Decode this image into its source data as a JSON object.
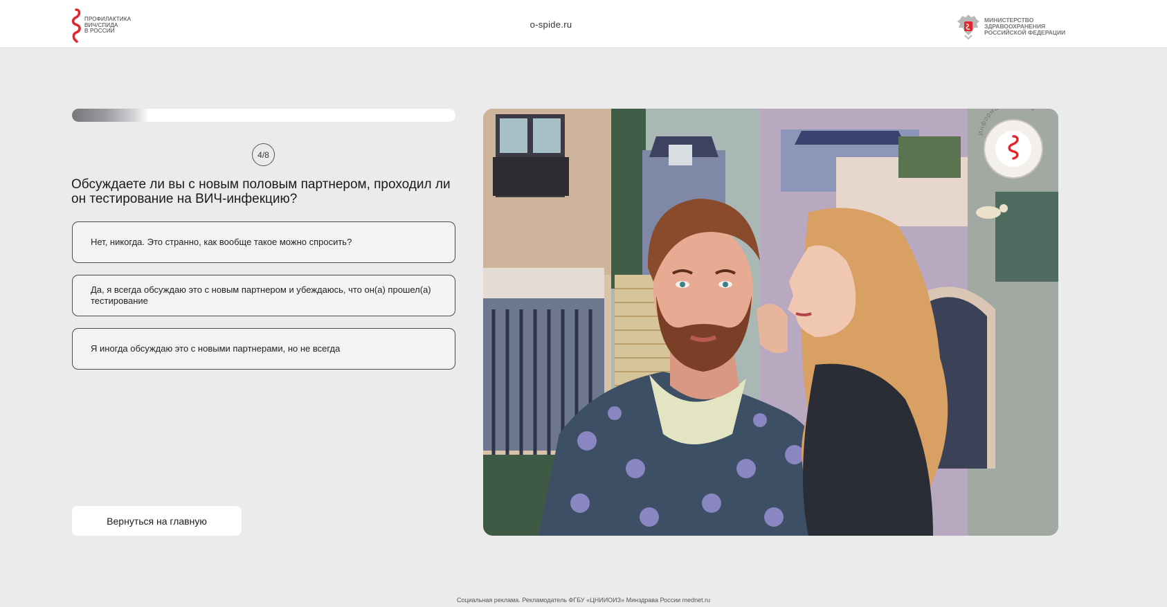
{
  "header": {
    "logo_text": [
      "ПРОФИЛАКТИКА",
      "ВИЧ/СПИДа",
      "В РОССИИ"
    ],
    "site_link": "o-spide.ru",
    "ministry_text": [
      "МИНИСТЕРСТВО",
      "ЗДРАВООХРАНЕНИЯ",
      "РОССИЙСКОЙ ФЕДЕРАЦИИ"
    ]
  },
  "quiz": {
    "progress": 0.2,
    "step": "4/8",
    "question": "Обсуждаете ли вы с новым половым партнером, проходил ли он тестирование на ВИЧ-инфекцию?",
    "options": [
      "Нет, никогда. Это странно, как вообще такое можно спросить?",
      "Да, я всегда обсуждаю это с новым партнером и убеждаюсь, что он(а) прошел(а) тестирование",
      "Я иногда обсуждаю это с новыми партнерами, но не всегда"
    ],
    "back_label": "Вернуться на главную"
  },
  "illustration": {
    "badge_text": "Информация о ВИЧ"
  },
  "footer": {
    "text": "Социальная реклама. Рекламодатель ФГБУ «ЦНИИОИЗ» Минздрава России mednet.ru"
  },
  "colors": {
    "accent": "#e3262c",
    "background": "#ebebeb"
  }
}
